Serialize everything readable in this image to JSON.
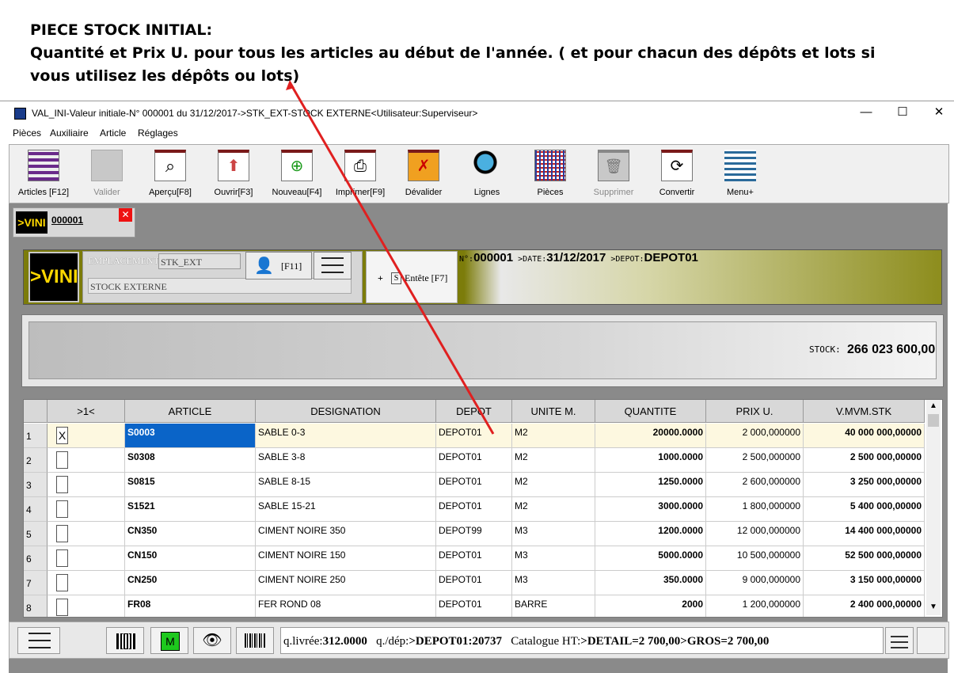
{
  "annotation": {
    "line1": "PIECE STOCK INITIAL:",
    "line2": "Quantité et Prix U. pour tous les articles au début de l'année.  ( et pour chacun des dépôts et lots si",
    "line3": "vous utilisez les  dépôts ou lots)"
  },
  "window": {
    "title": "VAL_INI-Valeur initiale-N° 000001 du 31/12/2017->STK_EXT-STOCK EXTERNE<Utilisateur:Superviseur>",
    "minimize": "—",
    "maximize": "☐",
    "close": "✕"
  },
  "menu": [
    "Pièces",
    "Auxiliaire",
    "Article",
    "Réglages"
  ],
  "toolbar": [
    {
      "label": "Articles [F12]",
      "icon": "articles-grid-icon",
      "disabled": false
    },
    {
      "label": "Valider",
      "icon": "validate-icon",
      "disabled": true
    },
    {
      "label": "Aperçu[F8]",
      "icon": "preview-magnifier-icon",
      "disabled": false
    },
    {
      "label": "Ouvrir[F3]",
      "icon": "open-arrow-up-icon",
      "disabled": false
    },
    {
      "label": "Nouveau[F4]",
      "icon": "new-plus-icon",
      "disabled": false
    },
    {
      "label": "Imprimer[F9]",
      "icon": "printer-icon",
      "disabled": false
    },
    {
      "label": "Dévalider",
      "icon": "devalidate-icon",
      "disabled": false
    },
    {
      "label": "Lignes",
      "icon": "search-lines-icon",
      "disabled": false
    },
    {
      "label": "Pièces",
      "icon": "pieces-grid-icon",
      "disabled": false
    },
    {
      "label": "Supprimer",
      "icon": "trash-icon",
      "disabled": true
    },
    {
      "label": "Convertir",
      "icon": "convert-cycle-icon",
      "disabled": false
    },
    {
      "label": "Menu+",
      "icon": "menu-lines-icon",
      "disabled": false
    }
  ],
  "doc_tab": {
    "logo": ">VINI",
    "number": "000001",
    "close": "✕"
  },
  "header": {
    "logo": ">VINI",
    "location_label": "EMPLACEMENT:",
    "location_code": "STK_EXT",
    "location_name": "STOCK EXTERNE",
    "user_shortcut": "[F11]",
    "entete_toggle": "+",
    "entete_label": "Entête [F7]",
    "no_label": "N°:",
    "no_value": "000001",
    "date_label": ">DATE:",
    "date_value": "31/12/2017",
    "depot_label": ">DEPOT:",
    "depot_value": "DEPOT01"
  },
  "stock": {
    "label": "STOCK:",
    "value": "266 023 600,00"
  },
  "grid": {
    "columns": [
      "",
      ">1<",
      "ARTICLE",
      "DESIGNATION",
      "DEPOT",
      "UNITE M.",
      "QUANTITE",
      "PRIX U.",
      "V.MVM.STK"
    ],
    "rows": [
      {
        "n": "1",
        "checked": "X",
        "article": "S0003",
        "designation": "SABLE 0-3",
        "depot": "DEPOT01",
        "unite": "M2",
        "quantite": "20000.0000",
        "prix": "2 000,000000",
        "valeur": "40 000 000,00000"
      },
      {
        "n": "2",
        "checked": "",
        "article": "S0308",
        "designation": "SABLE 3-8",
        "depot": "DEPOT01",
        "unite": "M2",
        "quantite": "1000.0000",
        "prix": "2 500,000000",
        "valeur": "2 500 000,00000"
      },
      {
        "n": "3",
        "checked": "",
        "article": "S0815",
        "designation": "SABLE 8-15",
        "depot": "DEPOT01",
        "unite": "M2",
        "quantite": "1250.0000",
        "prix": "2 600,000000",
        "valeur": "3 250 000,00000"
      },
      {
        "n": "4",
        "checked": "",
        "article": "S1521",
        "designation": "SABLE 15-21",
        "depot": "DEPOT01",
        "unite": "M2",
        "quantite": "3000.0000",
        "prix": "1 800,000000",
        "valeur": "5 400 000,00000"
      },
      {
        "n": "5",
        "checked": "",
        "article": "CN350",
        "designation": "CIMENT NOIRE 350",
        "depot": "DEPOT99",
        "unite": "M3",
        "quantite": "1200.0000",
        "prix": "12 000,000000",
        "valeur": "14 400 000,00000"
      },
      {
        "n": "6",
        "checked": "",
        "article": "CN150",
        "designation": "CIMENT NOIRE 150",
        "depot": "DEPOT01",
        "unite": "M3",
        "quantite": "5000.0000",
        "prix": "10 500,000000",
        "valeur": "52 500 000,00000"
      },
      {
        "n": "7",
        "checked": "",
        "article": "CN250",
        "designation": "CIMENT NOIRE 250",
        "depot": "DEPOT01",
        "unite": "M3",
        "quantite": "350.0000",
        "prix": "9 000,000000",
        "valeur": "3 150 000,00000"
      },
      {
        "n": "8",
        "checked": "",
        "article": "FR08",
        "designation": "FER ROND 08",
        "depot": "DEPOT01",
        "unite": "BARRE",
        "quantite": "2000",
        "prix": "1 200,000000",
        "valeur": "2 400 000,00000"
      }
    ]
  },
  "status": {
    "qlivree_label": "q.livrée:",
    "qlivree_value": "312.0000",
    "qdep_label": "q./dép:",
    "qdep_value": ">DEPOT01:20737",
    "catalogue_label": "Catalogue HT:",
    "catalogue_value": ">DETAIL=2 700,00>GROS=2 700,00"
  },
  "colors": {
    "accent_red": "#e02020",
    "olive": "#7c7c0a",
    "selected_cell": "#0a64c8",
    "logo_yellow": "#ffd800"
  }
}
